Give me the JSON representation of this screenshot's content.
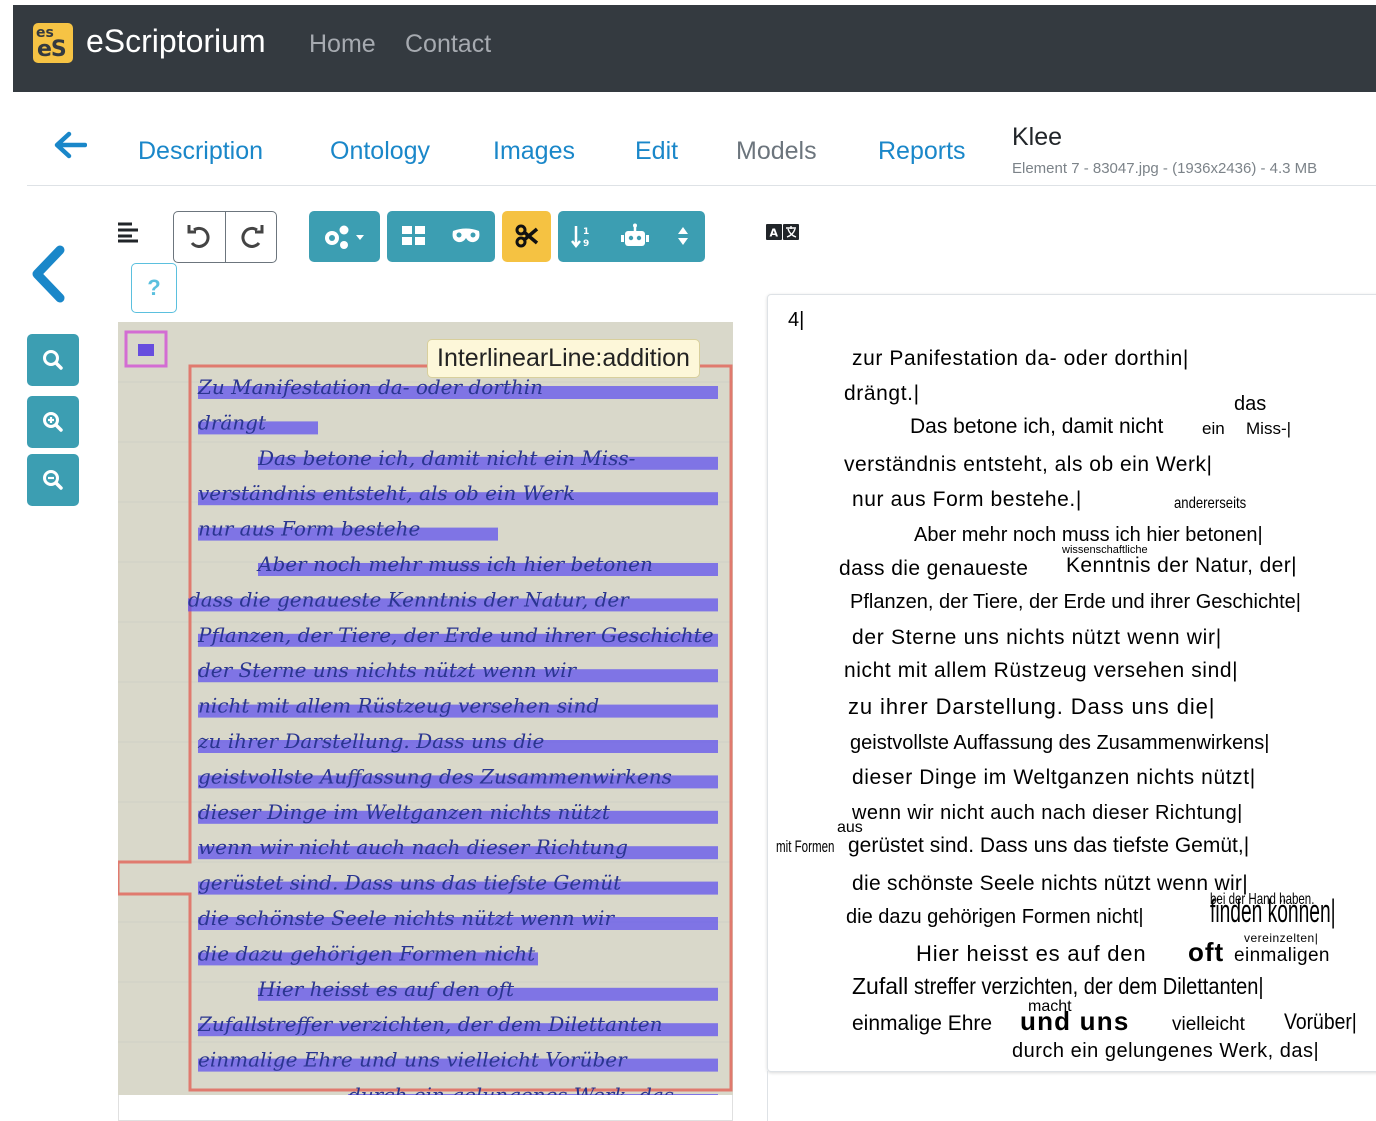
{
  "navbar": {
    "logo_top": "es",
    "logo_bottom": "eS",
    "brand": "eScriptorium",
    "links": [
      "Home",
      "Contact"
    ]
  },
  "tabs": {
    "items": [
      "Description",
      "Ontology",
      "Images",
      "Edit",
      "Models",
      "Reports"
    ],
    "title": "Klee",
    "subtitle": "Element 7 - 83047.jpg - (1936x2436) - 4.3 MB"
  },
  "toolbar": {
    "help": "?"
  },
  "image": {
    "tooltip": "InterlinearLine:addition",
    "handwriting": [
      "Zu Manifestation da- oder dorthin",
      "drängt",
      "Das betone ich, damit nicht ein Miss-",
      "verständnis entsteht, als ob ein Werk",
      "nur aus Form bestehe",
      "Aber noch mehr muss ich hier betonen",
      "dass die genaueste Kenntnis der Natur, der",
      "Pflanzen, der Tiere, der Erde und ihrer Geschichte",
      "der Sterne uns nichts nützt wenn wir",
      "nicht mit allem Rüstzeug versehen sind",
      "zu ihrer Darstellung. Dass uns die",
      "geistvollste Auffassung des Zusammenwirkens",
      "dieser Dinge im Weltganzen nichts nützt",
      "wenn wir nicht auch nach dieser Richtung",
      "gerüstet sind. Dass uns das tiefste Gemüt",
      "die schönste Seele nichts nützt wenn wir",
      "die dazu gehörigen Formen nicht",
      "Hier heisst es auf den oft",
      "Zufallstreffer verzichten, der dem Dilettanten",
      "einmalige Ehre und uns vielleicht Vorüber",
      "durch ein gelungenes Werk, das"
    ]
  },
  "transcription": {
    "page_marker": "4|",
    "l1": "zur Panifestation da- oder dorthin|",
    "l2": "drängt.|",
    "l3_sup": "das",
    "l3": "Das betone ich, damit nicht",
    "l3_ein": "ein",
    "l3_miss": "Miss-|",
    "l4": "verständnis entsteht, als ob ein Werk|",
    "l5": "nur aus Form bestehe.|",
    "l5_add": "andererseits",
    "l6": "Aber mehr noch muss ich hier betonen|",
    "l7_sup": "wissenschaftliche",
    "l7a": "dass die genaueste",
    "l7b": "Kenntnis der Natur, der|",
    "l8": "Pflanzen, der Tiere, der Erde und ihrer Geschichte|",
    "l9": "der Sterne uns nichts nützt wenn wir|",
    "l10": "nicht mit allem Rüstzeug versehen sind|",
    "l11": "zu ihrer Darstellung. Dass uns die|",
    "l12": "geistvollste Auffassung des Zusammenwirkens|",
    "l13": "dieser Dinge im Weltganzen nichts nützt|",
    "l14": "wenn wir nicht auch nach dieser Richtung|",
    "l15_margin": "mit Formen",
    "l15_sup": "aus",
    "l15": "gerüstet sind. Dass uns das tiefste Gemüt,|",
    "l16": "die schönste Seele nichts nützt wenn wir|",
    "l17": "die dazu gehörigen Formen nicht|",
    "l17_big": "finden können|",
    "l17_small": "bei der Hand haben.",
    "l18a": "Hier heisst es auf den",
    "l18_oft": "oft",
    "l18_sup": "vereinzelten|",
    "l18b": "einmaligen",
    "l19a": "Zufall",
    "l19b": "streffer verzichten, der dem Dilettanten|",
    "l20_sup": "macht",
    "l20a": "einmalige Ehre",
    "l20_und": "und uns",
    "l20b": "vielleicht",
    "l20c": "Vorüber|",
    "l21": "durch ein gelungenes Werk, das|"
  }
}
